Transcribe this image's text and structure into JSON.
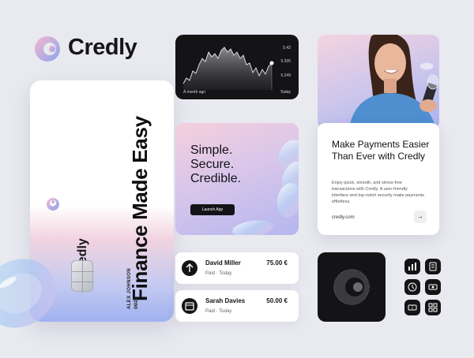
{
  "brand": {
    "name": "Credly"
  },
  "card": {
    "headline": "Finance Made Easy",
    "brand": "Credly",
    "holder": "ALEX JOHNSON",
    "expiry": "06/25"
  },
  "chart_card": {
    "y_ticks": [
      "5.42",
      "5.335",
      "5.249"
    ],
    "x_start": "A month ago",
    "x_end": "Today",
    "line_color": "#ffffff"
  },
  "slogan": {
    "lines": [
      "Simple.",
      "Secure.",
      "Credible."
    ],
    "button": "Launch App"
  },
  "promo": {
    "title": "Make Payments Easier Than Ever with Credly",
    "description": "Enjoy quick, smooth, and stress-free transactions with Credly. A user-friendly interface and top-notch security make payments effortless.",
    "url": "credly.com",
    "arrow": "→"
  },
  "transactions": [
    {
      "name": "David Miller",
      "status": "Paid · Today",
      "amount": "75.00 €",
      "icon": "arrow-up-icon"
    },
    {
      "name": "Sarah Davies",
      "status": "Paid · Today",
      "amount": "50.00 €",
      "icon": "calendar-icon"
    }
  ],
  "icons": [
    "chart-icon",
    "document-icon",
    "clock-icon",
    "cash-icon",
    "ticket-icon",
    "grid-icon"
  ],
  "colors": {
    "background": "#e9e9f0",
    "dark": "#141416",
    "accent_pink": "#f5cfdc",
    "accent_blue": "#aab3ef"
  }
}
